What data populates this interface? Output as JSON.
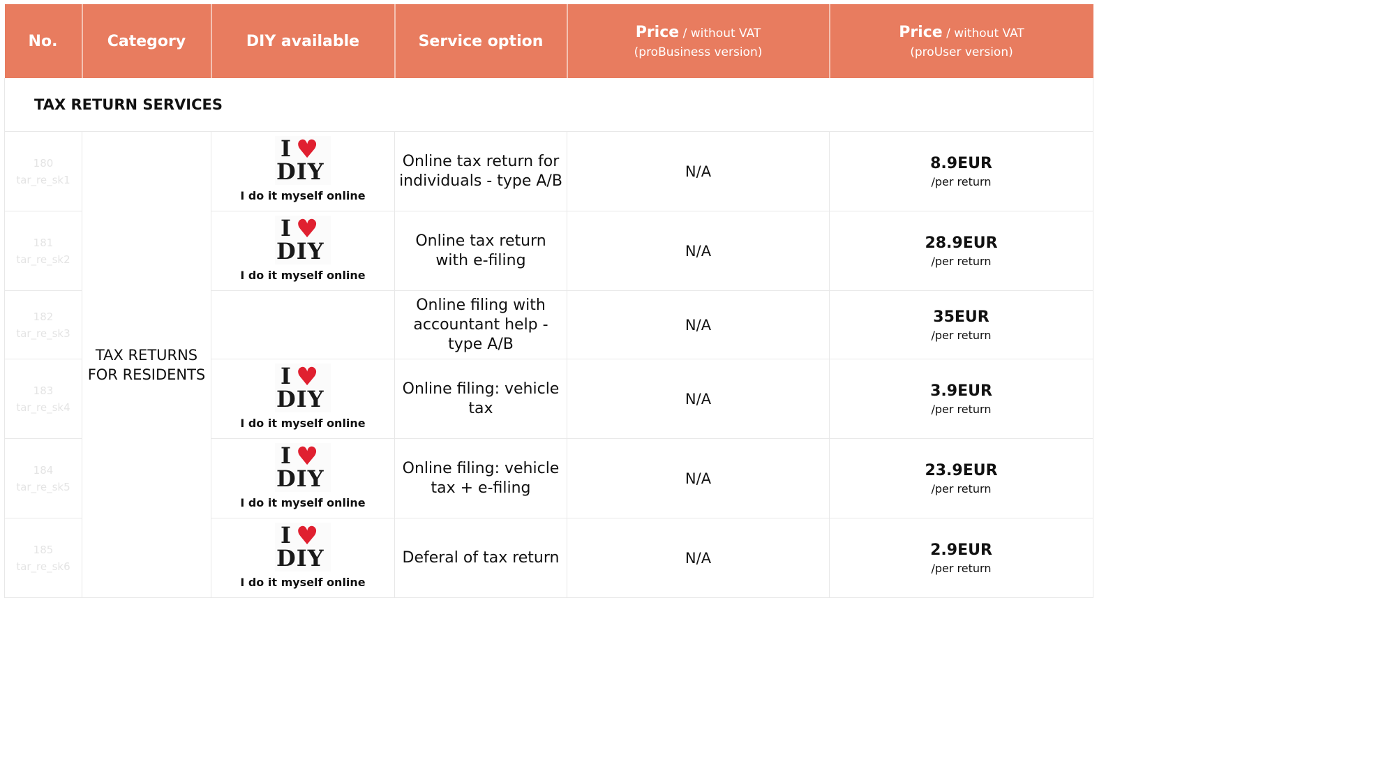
{
  "header": {
    "no": "No.",
    "category": "Category",
    "diy": "DIY available",
    "service": "Service option",
    "price_label": "Price",
    "without_vat": " / without VAT",
    "probusiness": "(proBusiness version)",
    "prouser": "(proUser version)"
  },
  "section": {
    "title": "TAX  RETURN SERVICES"
  },
  "category": "TAX RETURNS FOR RESIDENTS",
  "diy_logo": {
    "top": "I",
    "heart": "heart-icon",
    "word": "DIY",
    "caption": "I do it myself online"
  },
  "rows": [
    {
      "no": "180",
      "code": "tar_re_sk1",
      "service": "Online tax return for individuals - type A/B",
      "probusiness": "N/A",
      "price": "8.9EUR",
      "unit": "/per return"
    },
    {
      "no": "181",
      "code": "tar_re_sk2",
      "service": "Online tax return with e-filing",
      "probusiness": "N/A",
      "price": "28.9EUR",
      "unit": "/per return"
    },
    {
      "no": "182",
      "code": "tar_re_sk3",
      "service": "Online filing with accountant help - type A/B",
      "probusiness": "N/A",
      "price": "35EUR",
      "unit": "/per return"
    },
    {
      "no": "183",
      "code": "tar_re_sk4",
      "service": "Online filing: vehicle tax",
      "probusiness": "N/A",
      "price": "3.9EUR",
      "unit": "/per return"
    },
    {
      "no": "184",
      "code": "tar_re_sk5",
      "service": "Online filing: vehicle tax + e-filing",
      "probusiness": "N/A",
      "price": "23.9EUR",
      "unit": "/per return"
    },
    {
      "no": "185",
      "code": "tar_re_sk6",
      "service": "Deferal of tax return",
      "probusiness": "N/A",
      "price": "2.9EUR",
      "unit": "/per return"
    }
  ],
  "colors": {
    "header_bg": "#e87c5f",
    "heart": "#e02030"
  }
}
